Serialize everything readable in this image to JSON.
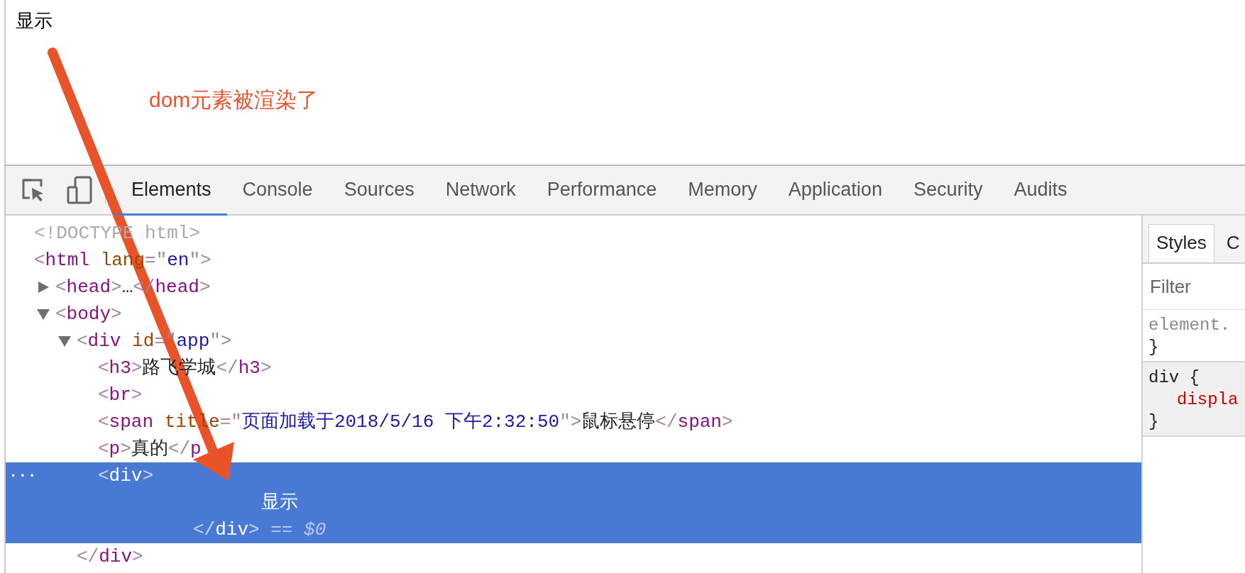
{
  "page": {
    "heading": "显示",
    "annotation": "dom元素被渲染了"
  },
  "devtools": {
    "tabs": [
      {
        "label": "Elements",
        "selected": true
      },
      {
        "label": "Console",
        "selected": false
      },
      {
        "label": "Sources",
        "selected": false
      },
      {
        "label": "Network",
        "selected": false
      },
      {
        "label": "Performance",
        "selected": false
      },
      {
        "label": "Memory",
        "selected": false
      },
      {
        "label": "Application",
        "selected": false
      },
      {
        "label": "Security",
        "selected": false
      },
      {
        "label": "Audits",
        "selected": false
      }
    ],
    "dom_tree": [
      {
        "kind": "node",
        "selected": false,
        "tokens": [
          {
            "kind": "doctype",
            "text": "<!DOCTYPE html>"
          }
        ]
      },
      {
        "kind": "node",
        "selected": false,
        "tokens": [
          {
            "kind": "punct",
            "text": "<"
          },
          {
            "kind": "tag",
            "text": "html"
          },
          {
            "kind": "attr",
            "text": " lang"
          },
          {
            "kind": "punct",
            "text": "=\""
          },
          {
            "kind": "value",
            "text": "en"
          },
          {
            "kind": "punct",
            "text": "\">"
          }
        ],
        "children": [
          {
            "kind": "node",
            "selected": false,
            "expanded": false,
            "tokens": [
              {
                "kind": "punct",
                "text": "<"
              },
              {
                "kind": "tag",
                "text": "head"
              },
              {
                "kind": "punct",
                "text": ">"
              },
              {
                "kind": "text",
                "text": "…"
              },
              {
                "kind": "punct",
                "text": "</"
              },
              {
                "kind": "tag",
                "text": "head"
              },
              {
                "kind": "punct",
                "text": ">"
              }
            ]
          },
          {
            "kind": "node",
            "selected": false,
            "expanded": true,
            "tokens": [
              {
                "kind": "punct",
                "text": "<"
              },
              {
                "kind": "tag",
                "text": "body"
              },
              {
                "kind": "punct",
                "text": ">"
              }
            ],
            "children": [
              {
                "kind": "node",
                "selected": false,
                "expanded": true,
                "tokens": [
                  {
                    "kind": "punct",
                    "text": "<"
                  },
                  {
                    "kind": "tag",
                    "text": "div"
                  },
                  {
                    "kind": "attr",
                    "text": " id"
                  },
                  {
                    "kind": "punct",
                    "text": "=\""
                  },
                  {
                    "kind": "value",
                    "text": "app"
                  },
                  {
                    "kind": "punct",
                    "text": "\">"
                  }
                ],
                "children": [
                  {
                    "kind": "node",
                    "selected": false,
                    "tokens": [
                      {
                        "kind": "punct",
                        "text": "<"
                      },
                      {
                        "kind": "tag",
                        "text": "h3"
                      },
                      {
                        "kind": "punct",
                        "text": ">"
                      },
                      {
                        "kind": "text",
                        "text": "路飞学城"
                      },
                      {
                        "kind": "punct",
                        "text": "</"
                      },
                      {
                        "kind": "tag",
                        "text": "h3"
                      },
                      {
                        "kind": "punct",
                        "text": ">"
                      }
                    ]
                  },
                  {
                    "kind": "node",
                    "selected": false,
                    "tokens": [
                      {
                        "kind": "punct",
                        "text": "<"
                      },
                      {
                        "kind": "tag",
                        "text": "br"
                      },
                      {
                        "kind": "punct",
                        "text": ">"
                      }
                    ]
                  },
                  {
                    "kind": "node",
                    "selected": false,
                    "tokens": [
                      {
                        "kind": "punct",
                        "text": "<"
                      },
                      {
                        "kind": "tag",
                        "text": "span"
                      },
                      {
                        "kind": "attr",
                        "text": " title"
                      },
                      {
                        "kind": "punct",
                        "text": "=\""
                      },
                      {
                        "kind": "value",
                        "text": "页面加载于2018/5/16 下午2:32:50"
                      },
                      {
                        "kind": "punct",
                        "text": "\">"
                      },
                      {
                        "kind": "text",
                        "text": "鼠标悬停"
                      },
                      {
                        "kind": "punct",
                        "text": "</"
                      },
                      {
                        "kind": "tag",
                        "text": "span"
                      },
                      {
                        "kind": "punct",
                        "text": ">"
                      }
                    ]
                  },
                  {
                    "kind": "node",
                    "selected": false,
                    "tokens": [
                      {
                        "kind": "punct",
                        "text": "<"
                      },
                      {
                        "kind": "tag",
                        "text": "p"
                      },
                      {
                        "kind": "punct",
                        "text": ">"
                      },
                      {
                        "kind": "text",
                        "text": "真的"
                      },
                      {
                        "kind": "punct",
                        "text": "</"
                      },
                      {
                        "kind": "tag",
                        "text": "p"
                      }
                    ]
                  },
                  {
                    "kind": "node",
                    "selected": true,
                    "gutter": "...",
                    "tokens": [
                      {
                        "kind": "punct",
                        "text": "<"
                      },
                      {
                        "kind": "tag",
                        "text": "div"
                      },
                      {
                        "kind": "punct",
                        "text": ">"
                      }
                    ],
                    "children": [
                      {
                        "kind": "text",
                        "text": "显示"
                      }
                    ],
                    "close": [
                      {
                        "kind": "punct",
                        "text": "</"
                      },
                      {
                        "kind": "tag",
                        "text": "div"
                      },
                      {
                        "kind": "punct",
                        "text": ">"
                      },
                      {
                        "kind": "ref",
                        "text": " == $0"
                      }
                    ]
                  }
                ],
                "close": [
                  {
                    "kind": "punct",
                    "text": "</"
                  },
                  {
                    "kind": "tag",
                    "text": "div"
                  },
                  {
                    "kind": "punct",
                    "text": ">"
                  }
                ]
              }
            ]
          }
        ]
      }
    ],
    "styles": {
      "tabs": [
        {
          "label": "Styles",
          "selected": true
        },
        {
          "label": "C",
          "selected": false
        }
      ],
      "filter": {
        "placeholder": "Filter"
      },
      "rules": [
        {
          "kind": "element",
          "selector": "element.",
          "close": "}"
        },
        {
          "kind": "user-agent",
          "selector": "div {",
          "declarations": [
            "displa"
          ],
          "close": "}"
        }
      ]
    }
  }
}
